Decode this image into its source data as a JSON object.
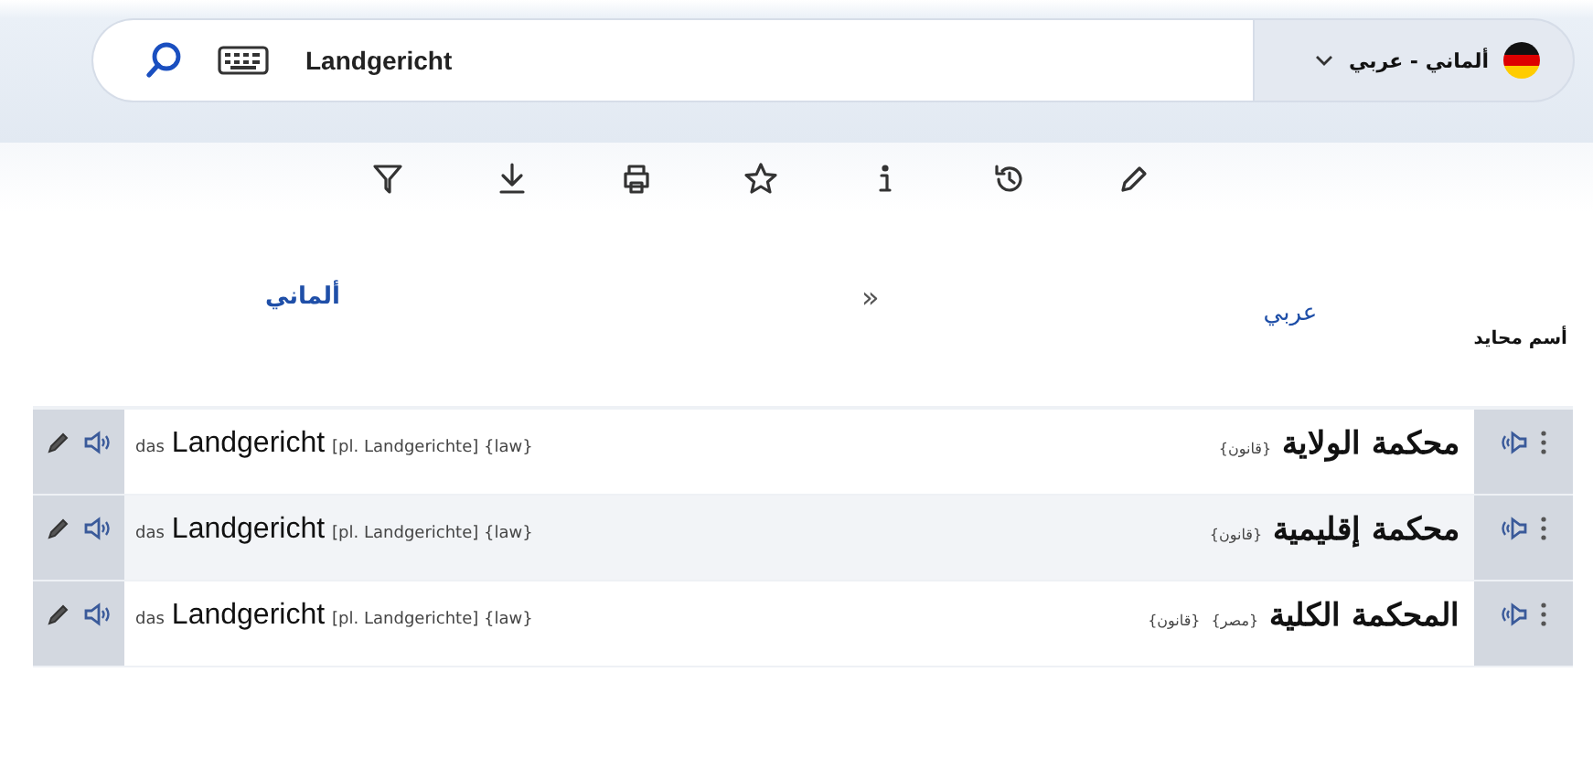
{
  "search": {
    "value": "Landgericht"
  },
  "language_pair": {
    "label": "ألماني - عربي"
  },
  "toolbar": [
    {
      "kind": "filter"
    },
    {
      "kind": "download"
    },
    {
      "kind": "print"
    },
    {
      "kind": "star"
    },
    {
      "kind": "info"
    },
    {
      "kind": "history"
    },
    {
      "kind": "edit"
    }
  ],
  "columns": {
    "left": "ألماني",
    "swap": "»",
    "right": "عربي"
  },
  "section": "أسم محايد",
  "rows": [
    {
      "shaded": false,
      "article": "das",
      "term": "Landgericht",
      "note": "[pl. Landgerichte] {law}",
      "ar_term": "محكمة الولاية",
      "ar_notes": [
        "{قانون}"
      ]
    },
    {
      "shaded": true,
      "article": "das",
      "term": "Landgericht",
      "note": "[pl. Landgerichte] {law}",
      "ar_term": "محكمة إقليمية",
      "ar_notes": [
        "{قانون}"
      ]
    },
    {
      "shaded": false,
      "article": "das",
      "term": "Landgericht",
      "note": "[pl. Landgerichte] {law}",
      "ar_term": "المحكمة الكلية",
      "ar_notes": [
        "{مصر}",
        "{قانون}"
      ]
    }
  ]
}
